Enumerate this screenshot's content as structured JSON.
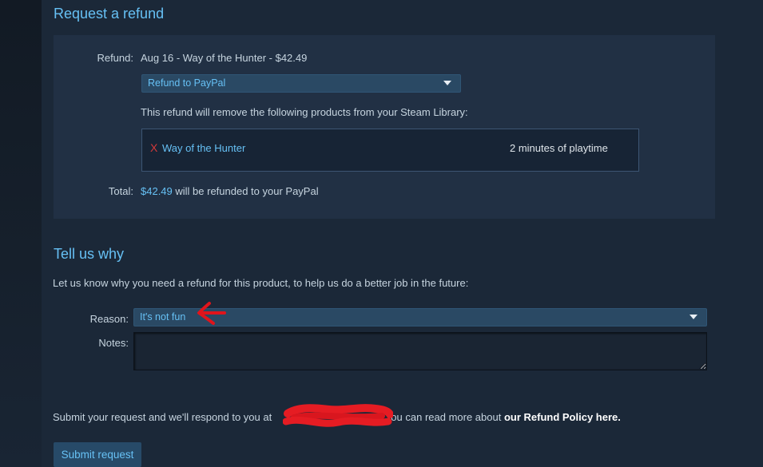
{
  "request_section": {
    "title": "Request a refund",
    "refund_label": "Refund:",
    "refund_value": "Aug 16 - Way of the Hunter - $42.49",
    "method_select": "Refund to PayPal",
    "products_intro": "This refund will remove the following products from your Steam Library:",
    "products": [
      {
        "remove_mark": "X",
        "name": "Way of the Hunter",
        "playtime": "2 minutes of playtime"
      }
    ],
    "total_label": "Total:",
    "total_amount": "$42.49",
    "total_suffix": " will be refunded to your PayPal"
  },
  "why_section": {
    "title": "Tell us why",
    "intro": "Let us know why you need a refund for this product, to help us do a better job in the future:",
    "reason_label": "Reason:",
    "reason_value": "It's not fun",
    "notes_label": "Notes:"
  },
  "footer": {
    "text_before": "Submit your request and we'll respond to you at",
    "text_after": ". You can read more about ",
    "policy_link": "our Refund Policy here.",
    "submit_button": "Submit request"
  },
  "icons": {
    "dropdown": "caret-down-icon",
    "remove": "remove-x-icon",
    "annotation_arrow": "red-arrow-annotation",
    "redaction": "red-scribble-redaction"
  },
  "colors": {
    "page_background": "#1b2838",
    "panel_background": "#213044",
    "accent": "#66c0f4",
    "dropdown_background": "#2a4964",
    "remove_red": "#d43a3a",
    "annotation_red": "#e0141b"
  }
}
